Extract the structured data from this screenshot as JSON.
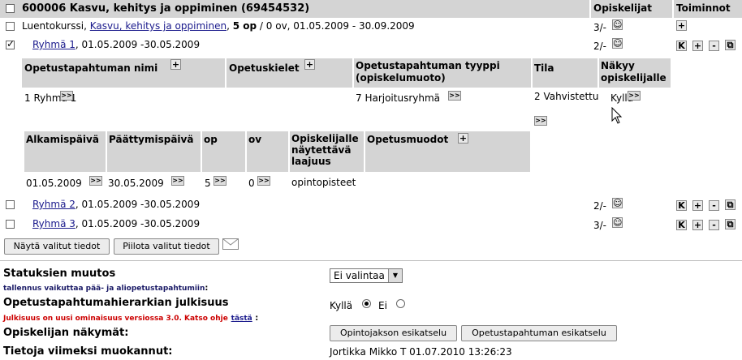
{
  "header": {
    "course_title": "600006 Kasvu, kehitys ja oppiminen (69454532)",
    "students_col": "Opiskelijat",
    "actions_col": "Toiminnot"
  },
  "course_row": {
    "type": "Luentokurssi",
    "link": "Kasvu, kehitys ja oppiminen",
    "credits": "5 op",
    "rest": "/ 0 ov, 01.05.2009 - 30.09.2009",
    "students": "3/-"
  },
  "groups": [
    {
      "link": "Ryhmä 1",
      "dates": ", 01.05.2009 -30.05.2009",
      "students": "2/-",
      "checked": true
    },
    {
      "link": "Ryhmä 2",
      "dates": ", 01.05.2009 -30.05.2009",
      "students": "2/-",
      "checked": false
    },
    {
      "link": "Ryhmä 3",
      "dates": ", 01.05.2009 -30.05.2009",
      "students": "3/-",
      "checked": false
    }
  ],
  "detail1": {
    "headers": [
      "Opetustapahtuman nimi",
      "Opetuskielet",
      "Opetustapahtuman tyyppi (opiskelumuoto)",
      "Tila",
      "Näkyy opiskelijalle"
    ],
    "name": "1 Ryhmä 1",
    "type": "7 Harjoitusryhmä",
    "state": "2 Vahvistettu",
    "visible": "Kyllä"
  },
  "detail2": {
    "headers": [
      "Alkamispäivä",
      "Päättymispäivä",
      "op",
      "ov",
      "Opiskelijalle näytettävä laajuus",
      "Opetusmuodot"
    ],
    "start": "01.05.2009",
    "end": "30.05.2009",
    "op": "5",
    "ov": "0",
    "scope": "opintopisteet"
  },
  "buttons": {
    "show_selected": "Näytä valitut tiedot",
    "hide_selected": "Piilota valitut tiedot",
    "course_preview": "Opintojakson esikatselu",
    "event_preview": "Opetustapahtuman esikatselu"
  },
  "bottom": {
    "status_label": "Statuksien muutos",
    "status_note": "tallennus vaikuttaa pää- ja aliopetustapahtumiin",
    "status_select": "Ei valintaa",
    "public_label": "Opetustapahtumahierarkian julkisuus",
    "public_note": "Julkisuus on uusi ominaisuus versiossa 3.0. Katso ohje",
    "public_note_link": "tästä",
    "yes": "Kyllä",
    "no": "Ei",
    "views_label": "Opiskelijan näkymät:",
    "modified_label": "Tietoja viimeksi muokannut:",
    "modified_value": "Jortikka Mikko T 01.07.2010 13:26:23"
  },
  "action_labels": {
    "k": "K",
    "plus": "+",
    "minus": "-"
  }
}
